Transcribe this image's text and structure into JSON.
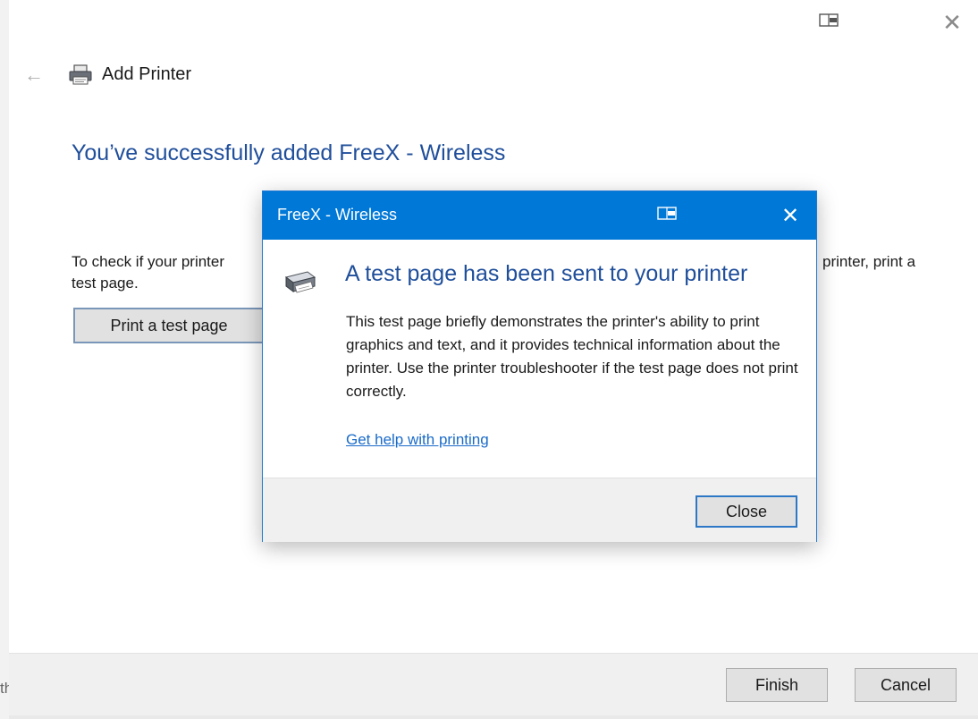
{
  "colors": {
    "accent": "#0078d7",
    "heading_blue": "#1f4e9b",
    "link_blue": "#1a6bc9"
  },
  "background": {
    "left_peek_text": "th"
  },
  "wizard": {
    "title": "Add Printer",
    "success_heading": "You’ve successfully added FreeX - Wireless",
    "check_text_left": "To check if your printer",
    "check_text_left_line2": "test page.",
    "check_text_right": "printer, print a",
    "print_test_button": "Print a test page",
    "finish_button": "Finish",
    "cancel_button": "Cancel",
    "icons": [
      "back-arrow-icon",
      "printer-icon",
      "snap-layout-icon",
      "close-icon"
    ]
  },
  "dialog": {
    "title": "FreeX - Wireless",
    "heading": "A test page has been sent to your printer",
    "body": "This test page briefly demonstrates the printer's ability to print graphics and text, and it provides technical information about the printer. Use the printer troubleshooter if the test page does not print correctly.",
    "help_link": "Get help with printing",
    "close_button": "Close",
    "icons": [
      "printer-icon",
      "snap-layout-icon",
      "close-icon"
    ]
  }
}
